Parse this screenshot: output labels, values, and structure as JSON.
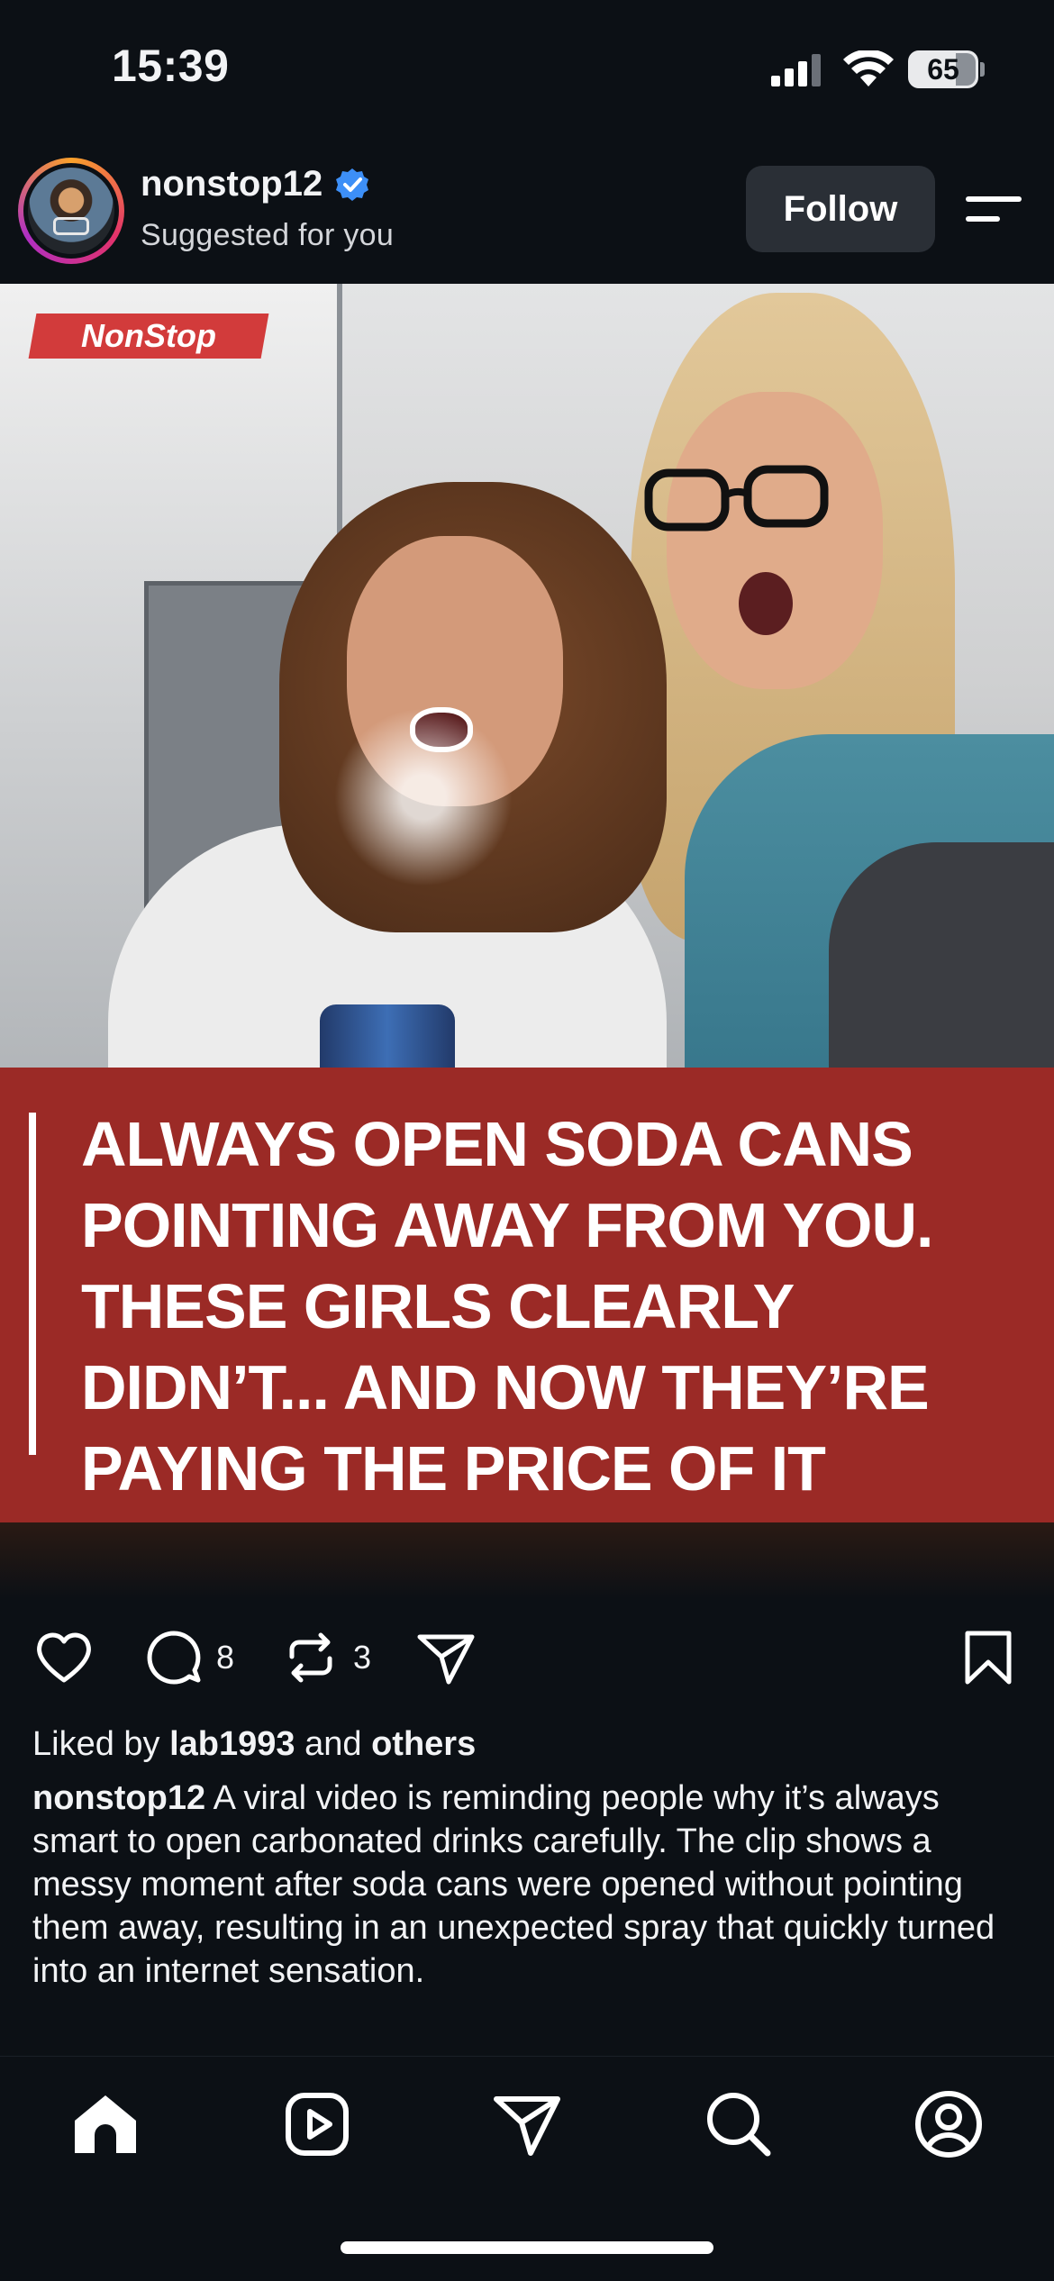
{
  "status_bar": {
    "time": "15:39",
    "battery": "65",
    "icons": [
      "cellular-signal-icon",
      "wifi-icon",
      "battery-icon"
    ]
  },
  "post": {
    "username": "nonstop12",
    "verified": true,
    "subtitle": "Suggested for you",
    "follow_label": "Follow",
    "image": {
      "brand_tag": "NonStop",
      "caption": "ALWAYS OPEN SODA CANS\nPOINTING AWAY FROM YOU.\nTHESE GIRLS CLEARLY\nDIDN’T... AND NOW THEY’RE\nPAYING THE PRICE OF IT"
    },
    "actions": {
      "comment_count": "8",
      "repost_count": "3"
    },
    "likes": {
      "prefix": "Liked by ",
      "user": "lab1993",
      "middle": " and ",
      "others": "others"
    },
    "description": {
      "author": "nonstop12",
      "text": " A viral video is reminding people why it’s always smart to open carbonated drinks carefully. The clip shows a messy moment after soda cans were opened without pointing them away, resulting in an unexpected spray that quickly turned into an internet sensation."
    }
  },
  "tab_bar": {
    "items": [
      "home-icon",
      "reels-icon",
      "direct-message-icon",
      "search-icon",
      "profile-icon"
    ]
  },
  "colors": {
    "background": "#0c1015",
    "caption_red": "#9b2a26",
    "verified_blue": "#3d8ff7",
    "follow_button": "#2a2f36"
  }
}
